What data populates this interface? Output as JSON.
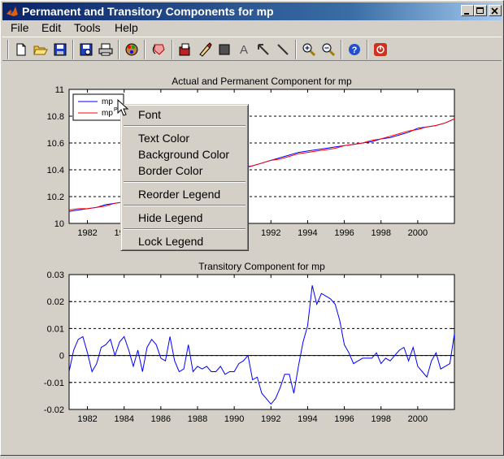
{
  "window": {
    "title": "Permanent and Transitory Components for mp"
  },
  "menu": [
    "File",
    "Edit",
    "Tools",
    "Help"
  ],
  "toolbar_icons": [
    "new-icon",
    "open-icon",
    "save-icon",
    "print-preview-icon",
    "print-icon",
    "color-icon",
    "rotate-icon",
    "copy-icon",
    "paint-icon",
    "rectangle-icon",
    "text-icon",
    "arrow-icon",
    "line-icon",
    "zoom-in-icon",
    "zoom-out-icon",
    "help-icon",
    "close-figure-icon"
  ],
  "toolbar_text_tool": "A",
  "context_menu": {
    "items": [
      "Font",
      "Text Color",
      "Background Color",
      "Border Color",
      "Reorder Legend",
      "Hide Legend",
      "Lock Legend"
    ]
  },
  "colors": {
    "series_actual": "#0000ff",
    "series_permanent": "#ff0000",
    "transitory": "#0000ff"
  },
  "chart_data": [
    {
      "type": "line",
      "title": "Actual and Permanent Component for mp",
      "legend": {
        "placement": "top-left",
        "entries": [
          "mp",
          "mp",
          "P"
        ]
      },
      "xlim": [
        1981,
        2002
      ],
      "ylim": [
        10,
        11
      ],
      "yticks": [
        "10",
        "10.2",
        "10.4",
        "10.6",
        "10.8",
        "11"
      ],
      "xticks": [
        "1982",
        "1984",
        "1986",
        "1988",
        "1990",
        "1992",
        "1994",
        "1996",
        "1998",
        "2000"
      ],
      "grid_y_dashed": true,
      "series": [
        {
          "name": "mp",
          "x": [
            1981,
            1981.5,
            1982,
            1982.5,
            1983,
            1983.5,
            1984,
            1984.5,
            1985,
            1985.5,
            1986,
            1986.5,
            1987,
            1987.5,
            1988,
            1988.5,
            1989,
            1989.5,
            1990,
            1990.5,
            1991,
            1991.5,
            1992,
            1992.5,
            1993,
            1993.5,
            1994,
            1994.5,
            1995,
            1995.5,
            1996,
            1996.5,
            1997,
            1997.5,
            1998,
            1998.5,
            1999,
            1999.5,
            2000,
            2000.5,
            2001,
            2001.5,
            2002
          ],
          "y": [
            10.09,
            10.1,
            10.11,
            10.12,
            10.14,
            10.15,
            10.16,
            10.19,
            10.2,
            10.22,
            10.24,
            10.26,
            10.28,
            10.3,
            10.31,
            10.34,
            10.36,
            10.38,
            10.4,
            10.42,
            10.43,
            10.45,
            10.47,
            10.49,
            10.51,
            10.53,
            10.54,
            10.55,
            10.56,
            10.57,
            10.58,
            10.59,
            10.6,
            10.61,
            10.63,
            10.64,
            10.66,
            10.68,
            10.71,
            10.72,
            10.73,
            10.75,
            10.78
          ]
        },
        {
          "name": "mp P",
          "x": [
            1981,
            1981.5,
            1982,
            1982.5,
            1983,
            1983.5,
            1984,
            1984.5,
            1985,
            1985.5,
            1986,
            1986.5,
            1987,
            1987.5,
            1988,
            1988.5,
            1989,
            1989.5,
            1990,
            1990.5,
            1991,
            1991.5,
            1992,
            1992.5,
            1993,
            1993.5,
            1994,
            1994.5,
            1995,
            1995.5,
            1996,
            1996.5,
            1997,
            1997.5,
            1998,
            1998.5,
            1999,
            1999.5,
            2000,
            2000.5,
            2001,
            2001.5,
            2002
          ],
          "y": [
            10.1,
            10.11,
            10.11,
            10.12,
            10.13,
            10.15,
            10.16,
            10.18,
            10.2,
            10.22,
            10.24,
            10.26,
            10.28,
            10.3,
            10.31,
            10.33,
            10.35,
            10.37,
            10.39,
            10.41,
            10.43,
            10.45,
            10.47,
            10.48,
            10.5,
            10.52,
            10.53,
            10.54,
            10.55,
            10.56,
            10.58,
            10.59,
            10.6,
            10.62,
            10.63,
            10.65,
            10.67,
            10.69,
            10.7,
            10.72,
            10.73,
            10.75,
            10.78
          ]
        }
      ]
    },
    {
      "type": "line",
      "title": "Transitory Component for mp",
      "xlim": [
        1981,
        2002
      ],
      "ylim": [
        -0.02,
        0.03
      ],
      "yticks": [
        "-0.02",
        "-0.01",
        "0",
        "0.01",
        "0.02",
        "0.03"
      ],
      "xticks": [
        "1982",
        "1984",
        "1986",
        "1988",
        "1990",
        "1992",
        "1994",
        "1996",
        "1998",
        "2000"
      ],
      "grid_y_dashed": true,
      "series": [
        {
          "name": "",
          "x": [
            1981,
            1981.25,
            1981.5,
            1981.75,
            1982,
            1982.25,
            1982.5,
            1982.75,
            1983,
            1983.25,
            1983.5,
            1983.75,
            1984,
            1984.25,
            1984.5,
            1984.75,
            1985,
            1985.25,
            1985.5,
            1985.75,
            1986,
            1986.25,
            1986.5,
            1986.75,
            1987,
            1987.25,
            1987.5,
            1987.75,
            1988,
            1988.25,
            1988.5,
            1988.75,
            1989,
            1989.25,
            1989.5,
            1989.75,
            1990,
            1990.25,
            1990.5,
            1990.75,
            1991,
            1991.25,
            1991.5,
            1991.75,
            1992,
            1992.25,
            1992.5,
            1992.75,
            1993,
            1993.25,
            1993.5,
            1993.75,
            1994,
            1994.25,
            1994.5,
            1994.75,
            1995,
            1995.25,
            1995.5,
            1995.75,
            1996,
            1996.25,
            1996.5,
            1996.75,
            1997,
            1997.25,
            1997.5,
            1997.75,
            1998,
            1998.25,
            1998.5,
            1998.75,
            1999,
            1999.25,
            1999.5,
            1999.75,
            2000,
            2000.25,
            2000.5,
            2000.75,
            2001,
            2001.25,
            2001.5,
            2001.75,
            2002
          ],
          "y": [
            -0.006,
            0.002,
            0.006,
            0.007,
            0.001,
            -0.006,
            -0.003,
            0.003,
            0.004,
            0.006,
            0.0,
            0.005,
            0.007,
            0.002,
            -0.004,
            0.002,
            -0.006,
            0.003,
            0.006,
            0.004,
            -0.001,
            -0.002,
            0.007,
            -0.002,
            -0.006,
            -0.005,
            0.004,
            -0.006,
            -0.004,
            -0.005,
            -0.004,
            -0.006,
            -0.006,
            -0.004,
            -0.007,
            -0.006,
            -0.006,
            -0.003,
            -0.002,
            0.0,
            -0.009,
            -0.008,
            -0.014,
            -0.016,
            -0.018,
            -0.016,
            -0.012,
            -0.007,
            -0.007,
            -0.014,
            -0.004,
            0.005,
            0.011,
            0.026,
            0.019,
            0.023,
            0.022,
            0.021,
            0.019,
            0.013,
            0.004,
            0.001,
            -0.003,
            -0.002,
            -0.001,
            -0.001,
            -0.001,
            0.001,
            -0.003,
            -0.001,
            -0.002,
            0.0,
            0.002,
            0.003,
            -0.002,
            0.003,
            -0.004,
            -0.006,
            -0.008,
            -0.002,
            0.001,
            -0.005,
            -0.004,
            -0.003,
            0.008
          ]
        }
      ]
    }
  ]
}
